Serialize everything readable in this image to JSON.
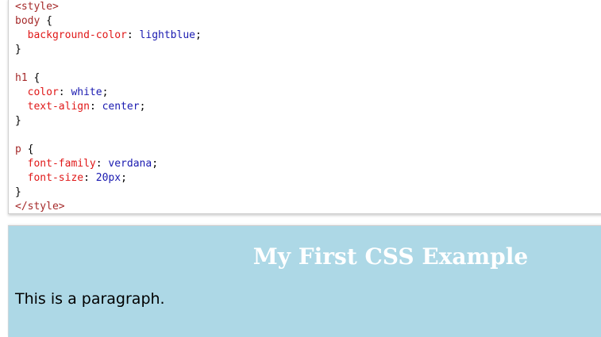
{
  "code_editor": {
    "lines": {
      "l1": {
        "open": "<style>"
      },
      "l2": {
        "selector": "body",
        "brace": " {"
      },
      "l3": {
        "property": "background-color",
        "colon": ": ",
        "value": "lightblue",
        "semi": ";"
      },
      "l4": {
        "brace": "}"
      },
      "l6": {
        "selector": "h1",
        "brace": " {"
      },
      "l7": {
        "property": "color",
        "colon": ": ",
        "value": "white",
        "semi": ";"
      },
      "l8": {
        "property": "text-align",
        "colon": ": ",
        "value": "center",
        "semi": ";"
      },
      "l9": {
        "brace": "}"
      },
      "l11": {
        "selector": "p",
        "brace": " {"
      },
      "l12": {
        "property": "font-family",
        "colon": ": ",
        "value": "verdana",
        "semi": ";"
      },
      "l13": {
        "property": "font-size",
        "colon": ": ",
        "value": "20px",
        "semi": ";"
      },
      "l14": {
        "brace": "}"
      },
      "l15": {
        "close": "</style>"
      }
    },
    "colors": {
      "tag": "#a52a2a",
      "property": "#e01818",
      "value": "#1a1ab0"
    }
  },
  "result": {
    "heading": "My First CSS Example",
    "paragraph": "This is a paragraph.",
    "background_color": "#add8e6",
    "heading_color": "#ffffff"
  }
}
